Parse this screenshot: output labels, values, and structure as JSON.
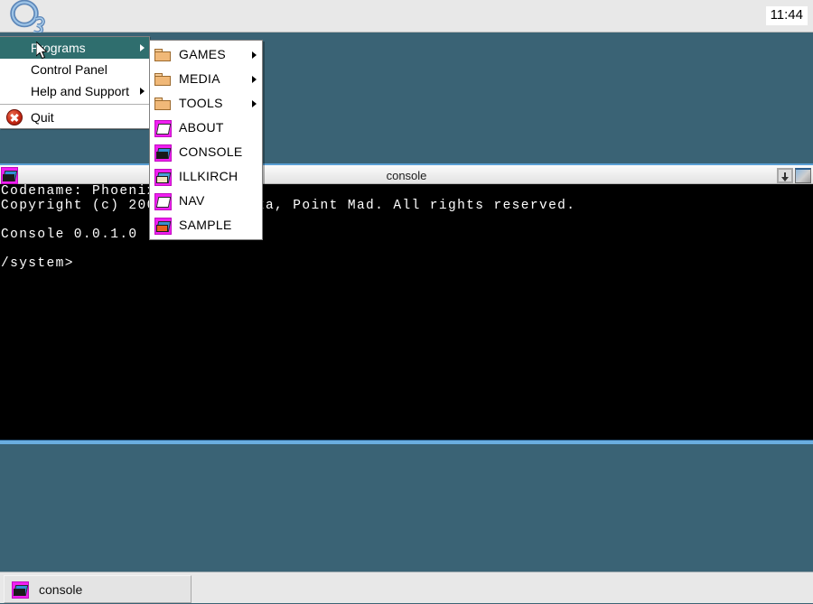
{
  "topbar": {
    "logo_alt": "os-logo",
    "clock": "11:44"
  },
  "start_menu": {
    "items": [
      {
        "label": "Programs",
        "icon": "none",
        "has_arrow": true,
        "selected": true
      },
      {
        "label": "Control Panel",
        "icon": "none",
        "has_arrow": false,
        "selected": false
      },
      {
        "label": "Help and Support",
        "icon": "none",
        "has_arrow": true,
        "selected": false
      },
      {
        "label": "Quit",
        "icon": "quit-icon",
        "has_arrow": false,
        "selected": false
      }
    ]
  },
  "programs_submenu": {
    "items": [
      {
        "label": "GAMES",
        "icon": "folder-icon",
        "has_arrow": true
      },
      {
        "label": "MEDIA",
        "icon": "folder-icon",
        "has_arrow": true
      },
      {
        "label": "TOOLS",
        "icon": "folder-icon",
        "has_arrow": true
      },
      {
        "label": "ABOUT",
        "icon": "app-icon-about",
        "has_arrow": false
      },
      {
        "label": "CONSOLE",
        "icon": "app-icon-console",
        "has_arrow": false
      },
      {
        "label": "ILLKIRCH",
        "icon": "app-icon-illkirch",
        "has_arrow": false
      },
      {
        "label": "NAV",
        "icon": "app-icon-nav",
        "has_arrow": false
      },
      {
        "label": "SAMPLE",
        "icon": "app-icon-sample",
        "has_arrow": false
      }
    ]
  },
  "console_window": {
    "title": "console",
    "icon": "console-icon",
    "minimize_label": "minimize",
    "maximize_label": "maximize",
    "lines": [
      "Codename: Phoenix 0.5.3.0",
      "Copyright (c) 2009 Lukas Lipka, Point Mad. All rights reserved.",
      "",
      "Console 0.0.1.0",
      "",
      "/system>"
    ]
  },
  "taskbar": {
    "buttons": [
      {
        "label": "console",
        "icon": "console-icon"
      }
    ]
  },
  "colors": {
    "desktop": "#3a6375",
    "menu_highlight": "#2f6e6e",
    "app_icon_bg": "#f11ff1",
    "window_accent": "#5a9fd4",
    "chrome": "#e8e8e8"
  }
}
